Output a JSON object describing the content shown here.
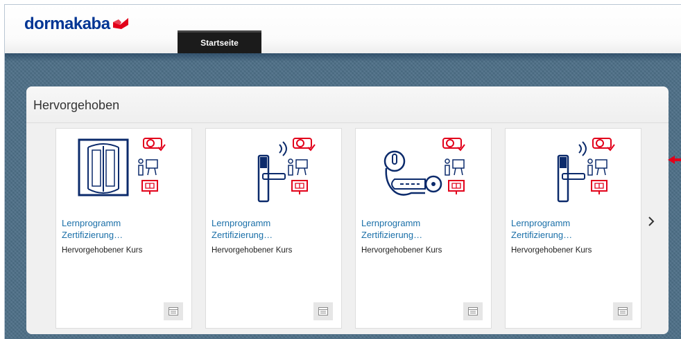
{
  "brand": {
    "name": "dormakaba"
  },
  "nav": {
    "tabs": [
      {
        "label": "Startseite",
        "active": true
      }
    ]
  },
  "featured": {
    "title": "Hervorgehoben",
    "cards": [
      {
        "title_line1": "Lernprogramm",
        "title_line2": "Zertifizierung…",
        "subtitle": "Hervorgehobener Kurs",
        "icon": "revolving-door-icon"
      },
      {
        "title_line1": "Lernprogramm",
        "title_line2": "Zertifizierung…",
        "subtitle": "Hervorgehobener Kurs",
        "icon": "wireless-door-handle-icon"
      },
      {
        "title_line1": "Lernprogramm",
        "title_line2": "Zertifizierung…",
        "subtitle": "Hervorgehobener Kurs",
        "icon": "key-cylinder-icon"
      },
      {
        "title_line1": "Lernprogramm",
        "title_line2": "Zertifizierung…",
        "subtitle": "Hervorgehobener Kurs",
        "icon": "wireless-door-handle-icon"
      }
    ],
    "next_icon": "chevron-right-icon"
  },
  "colors": {
    "brand_blue": "#003594",
    "brand_red": "#e2001a",
    "link_blue": "#1a6fa8",
    "background": "#4d6f87"
  }
}
